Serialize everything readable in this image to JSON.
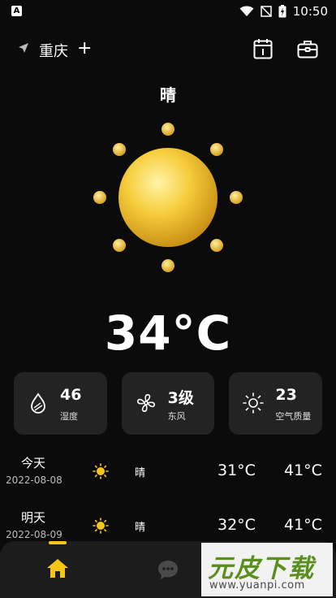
{
  "status_bar": {
    "time": "10:50",
    "notification_letter": "A"
  },
  "header": {
    "city": "重庆"
  },
  "current": {
    "condition": "晴",
    "temperature": "34°C"
  },
  "cards": [
    {
      "icon": "water-drop-icon",
      "value": "46",
      "label": "湿度"
    },
    {
      "icon": "fan-icon",
      "value": "3级",
      "label": "东风"
    },
    {
      "icon": "sun-outline-icon",
      "value": "23",
      "label": "空气质量"
    }
  ],
  "forecast": [
    {
      "day": "今天",
      "date": "2022-08-08",
      "icon": "sun-icon",
      "condition": "晴",
      "low": "31°C",
      "high": "41°C"
    },
    {
      "day": "明天",
      "date": "2022-08-09",
      "icon": "sun-icon",
      "condition": "晴",
      "low": "32°C",
      "high": "41°C"
    }
  ],
  "tabbar": {
    "active_tab": "home",
    "tabs": [
      "home-icon",
      "chat-icon"
    ]
  },
  "watermark": {
    "title": "元皮下载",
    "url": "www.yuanpi.com"
  },
  "colors": {
    "background": "#0b0b0b",
    "card": "#232323",
    "accent": "#f5c518",
    "sun": "#f2c53d"
  }
}
